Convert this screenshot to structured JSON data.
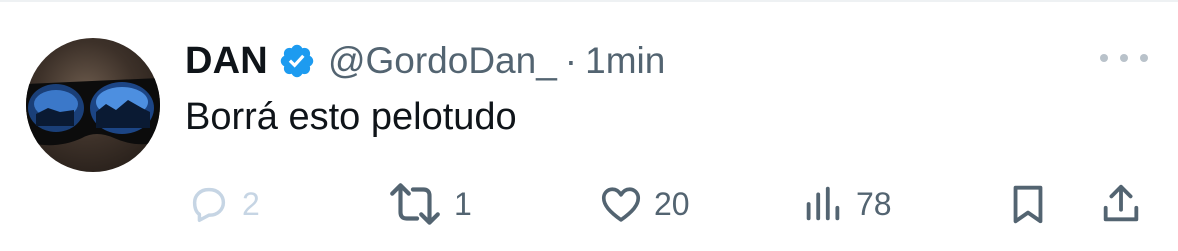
{
  "tweet": {
    "display_name": "DAN",
    "handle": "@GordoDan_",
    "separator": "·",
    "time": "1min",
    "text": "Borrá esto pelotudo",
    "verified": true
  },
  "actions": {
    "reply_count": "2",
    "retweet_count": "1",
    "like_count": "20",
    "views_count": "78"
  },
  "icons": [
    "avatar",
    "verified-badge-icon",
    "more-icon",
    "reply-icon",
    "retweet-icon",
    "like-icon",
    "views-icon",
    "bookmark-icon",
    "share-icon"
  ],
  "colors": {
    "primary_text": "#0f1419",
    "secondary_text": "#536471",
    "verified_blue": "#1d9bf0",
    "disabled_reply": "#c6d5e4"
  }
}
